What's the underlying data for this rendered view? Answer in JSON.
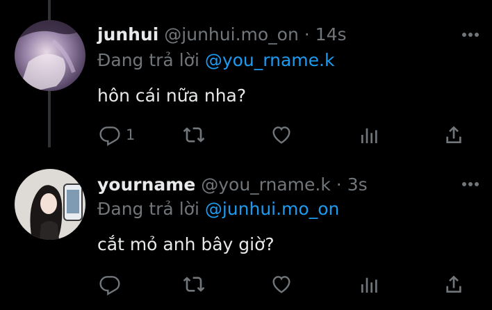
{
  "tweets": [
    {
      "name": "junhui",
      "handle": "@junhui.mo_on",
      "separator": "·",
      "time": "14s",
      "replying_label": "Đang trả lời",
      "replying_to": "@you_rname.k",
      "text": "hôn cái nữa nha?",
      "reply_count": "1"
    },
    {
      "name": "yourname",
      "handle": "@you_rname.k",
      "separator": "·",
      "time": "3s",
      "replying_label": "Đang trả lời",
      "replying_to": "@junhui.mo_on",
      "text": "cắt mỏ anh bây giờ?",
      "reply_count": ""
    }
  ],
  "icons": {
    "more": "more-horizontal-icon",
    "reply": "reply-bubble-icon",
    "retweet": "retweet-icon",
    "like": "heart-icon",
    "analytics": "analytics-bars-icon",
    "share": "share-upload-icon"
  },
  "colors": {
    "background": "#000000",
    "text": "#e7e9ea",
    "muted": "#71767b",
    "mention": "#1d9bf0",
    "thread_line": "#2f3336"
  }
}
